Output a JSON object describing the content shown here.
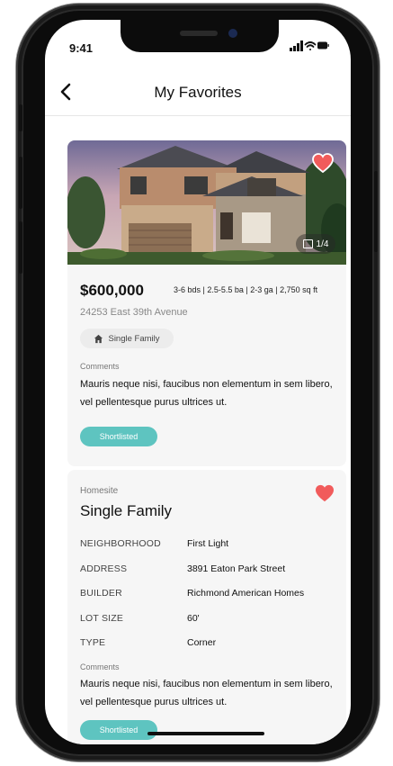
{
  "status_bar": {
    "time": "9:41"
  },
  "nav": {
    "title": "My Favorites"
  },
  "listing": {
    "price": "$600,000",
    "specs": "3-6 bds | 2.5-5.5 ba | 2-3 ga | 2,750 sq ft",
    "address": "24253 East 39th Avenue",
    "type_chip": "Single Family",
    "photo_counter": "1/4",
    "comments_label": "Comments",
    "comment": "Mauris neque nisi, faucibus non elementum in sem libero, vel pellentesque purus ultrices ut.",
    "status_pill": "Shortlisted"
  },
  "homesite": {
    "label": "Homesite",
    "title": "Single Family",
    "details": [
      {
        "key": "NEIGHBORHOOD",
        "value": "First Light"
      },
      {
        "key": "ADDRESS",
        "value": "3891 Eaton Park Street"
      },
      {
        "key": "BUILDER",
        "value": "Richmond American Homes"
      },
      {
        "key": "LOT SIZE",
        "value": "60'"
      },
      {
        "key": "TYPE",
        "value": "Corner"
      }
    ],
    "comments_label": "Comments",
    "comment": "Mauris neque nisi, faucibus non elementum in sem libero, vel pellentesque purus ultrices ut.",
    "status_pill": "Shortlisted"
  },
  "colors": {
    "accent_teal": "#5ec4c0",
    "favorite_red": "#f15b5b"
  },
  "icons": [
    "back-arrow-icon",
    "signal-icon",
    "wifi-icon",
    "battery-icon",
    "heart-icon",
    "gallery-icon",
    "home-icon"
  ]
}
